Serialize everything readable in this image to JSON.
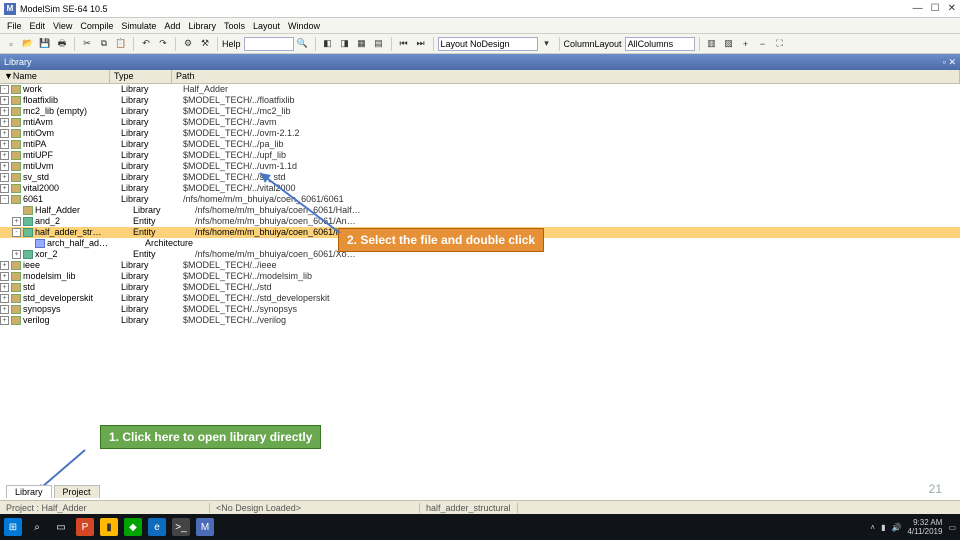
{
  "title": "ModelSim SE-64 10.5",
  "menu": [
    "File",
    "Edit",
    "View",
    "Compile",
    "Simulate",
    "Add",
    "Library",
    "Tools",
    "Layout",
    "Window"
  ],
  "toolbar": {
    "help_label": "Help",
    "layout_label": "Layout NoDesign",
    "collayout_label": "ColumnLayout AllColumns"
  },
  "panel_title": "Library",
  "columns": {
    "name": "▼Name",
    "type": "Type",
    "path": "Path"
  },
  "rows": [
    {
      "exp": "-",
      "depth": 0,
      "icon": "lib",
      "name": "work",
      "type": "Library",
      "path": "Half_Adder"
    },
    {
      "exp": "+",
      "depth": 0,
      "icon": "lib",
      "name": "floatfixlib",
      "type": "Library",
      "path": "$MODEL_TECH/../floatfixlib"
    },
    {
      "exp": "+",
      "depth": 0,
      "icon": "lib",
      "name": "mc2_lib (empty)",
      "type": "Library",
      "path": "$MODEL_TECH/../mc2_lib"
    },
    {
      "exp": "+",
      "depth": 0,
      "icon": "lib",
      "name": "mtiAvm",
      "type": "Library",
      "path": "$MODEL_TECH/../avm"
    },
    {
      "exp": "+",
      "depth": 0,
      "icon": "lib",
      "name": "mtiOvm",
      "type": "Library",
      "path": "$MODEL_TECH/../ovm-2.1.2"
    },
    {
      "exp": "+",
      "depth": 0,
      "icon": "lib",
      "name": "mtiPA",
      "type": "Library",
      "path": "$MODEL_TECH/../pa_lib"
    },
    {
      "exp": "+",
      "depth": 0,
      "icon": "lib",
      "name": "mtiUPF",
      "type": "Library",
      "path": "$MODEL_TECH/../upf_lib"
    },
    {
      "exp": "+",
      "depth": 0,
      "icon": "lib",
      "name": "mtiUvm",
      "type": "Library",
      "path": "$MODEL_TECH/../uvm-1.1d"
    },
    {
      "exp": "+",
      "depth": 0,
      "icon": "lib",
      "name": "sv_std",
      "type": "Library",
      "path": "$MODEL_TECH/../sv_std"
    },
    {
      "exp": "+",
      "depth": 0,
      "icon": "lib",
      "name": "vital2000",
      "type": "Library",
      "path": "$MODEL_TECH/../vital2000"
    },
    {
      "exp": "-",
      "depth": 0,
      "icon": "lib",
      "name": "6061",
      "type": "Library",
      "path": "/nfs/home/m/m_bhuiya/coen_6061/6061"
    },
    {
      "exp": "",
      "depth": 1,
      "icon": "lib",
      "name": "Half_Adder",
      "type": "Library",
      "path": "/nfs/home/m/m_bhuiya/coen_6061/Half…"
    },
    {
      "exp": "+",
      "depth": 1,
      "icon": "ent",
      "name": "and_2",
      "type": "Entity",
      "path": "/nfs/home/m/m_bhuiya/coen_6061/An…"
    },
    {
      "exp": "-",
      "depth": 1,
      "icon": "ent",
      "name": "half_adder_str…",
      "type": "Entity",
      "path": "/nfs/home/m/m_bhuiya/coen_6061/Ha…",
      "sel": true
    },
    {
      "exp": "",
      "depth": 2,
      "icon": "arch",
      "name": "arch_half_ad…",
      "type": "Architecture",
      "path": ""
    },
    {
      "exp": "+",
      "depth": 1,
      "icon": "ent",
      "name": "xor_2",
      "type": "Entity",
      "path": "/nfs/home/m/m_bhuiya/coen_6061/Xo…"
    },
    {
      "exp": "+",
      "depth": 0,
      "icon": "lib",
      "name": "ieee",
      "type": "Library",
      "path": "$MODEL_TECH/../ieee"
    },
    {
      "exp": "+",
      "depth": 0,
      "icon": "lib",
      "name": "modelsim_lib",
      "type": "Library",
      "path": "$MODEL_TECH/../modelsim_lib"
    },
    {
      "exp": "+",
      "depth": 0,
      "icon": "lib",
      "name": "std",
      "type": "Library",
      "path": "$MODEL_TECH/../std"
    },
    {
      "exp": "+",
      "depth": 0,
      "icon": "lib",
      "name": "std_developerskit",
      "type": "Library",
      "path": "$MODEL_TECH/../std_developerskit"
    },
    {
      "exp": "+",
      "depth": 0,
      "icon": "lib",
      "name": "synopsys",
      "type": "Library",
      "path": "$MODEL_TECH/../synopsys"
    },
    {
      "exp": "+",
      "depth": 0,
      "icon": "lib",
      "name": "verilog",
      "type": "Library",
      "path": "$MODEL_TECH/../verilog"
    }
  ],
  "annot1": "1. Click here to open library directly",
  "annot2": "2. Select the file  and double click",
  "tabs": {
    "library": "Library",
    "project": "Project"
  },
  "status": {
    "project": "Project : Half_Adder",
    "now": "<No Design Loaded>",
    "context": "half_adder_structural"
  },
  "pagenum": "21",
  "tray": {
    "time": "9:32 AM",
    "date": "4/11/2019"
  }
}
